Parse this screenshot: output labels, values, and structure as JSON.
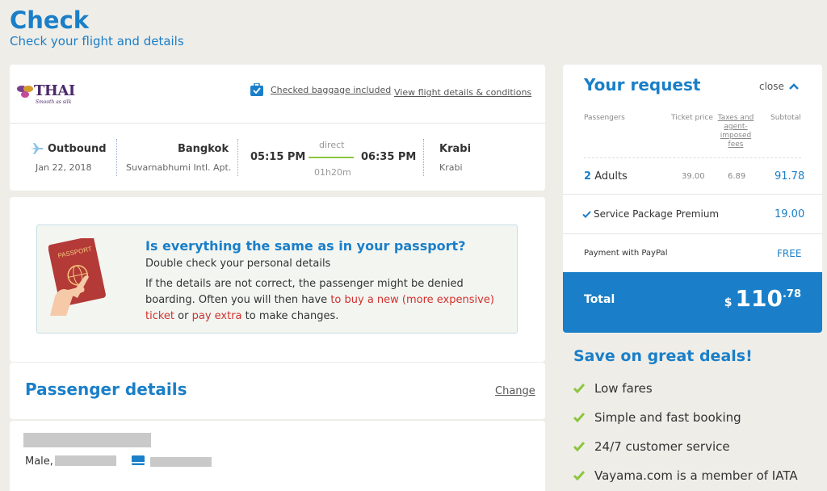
{
  "page": {
    "title": "Check",
    "subtitle": "Check your flight and details"
  },
  "flight": {
    "airline_logo_text": "THAI",
    "airline_logo_tagline": "Smooth as silk",
    "baggage_label": "Checked baggage included",
    "details_link": "View flight details & conditions",
    "direction": "Outbound",
    "date": "Jan 22, 2018",
    "origin_city": "Bangkok",
    "origin_airport": "Suvarnabhumi Intl. Apt.",
    "depart_time": "05:15 PM",
    "stop_type": "direct",
    "arrive_time": "06:35 PM",
    "duration": "01h20m",
    "dest_city": "Krabi",
    "dest_airport": "Krabi"
  },
  "passport_warning": {
    "title": "Is everything the same as in your passport?",
    "subtitle": "Double check your personal details",
    "body_1": "If the details are not correct, the passenger might be denied boarding. Often you will then have ",
    "link_1": "to buy a new (more expensive) ticket",
    "body_2": " or ",
    "link_2": "pay extra",
    "body_3": " to make changes.",
    "passport_label": "PASSPORT"
  },
  "passenger": {
    "title": "Passenger details",
    "change_label": "Change",
    "gender": "Male,"
  },
  "request": {
    "title": "Your request",
    "close_label": "close",
    "headers": {
      "passengers": "Passengers",
      "ticket_price": "Ticket price",
      "taxes": "Taxes and agent-imposed fees",
      "subtotal": "Subtotal"
    },
    "adults_count": "2",
    "adults_label": "Adults",
    "ticket_price": "39.00",
    "taxes": "6.89",
    "subtotal": "91.78",
    "service_label": "Service Package Premium",
    "service_price": "19.00",
    "payment_label": "Payment with PayPal",
    "payment_price": "FREE",
    "total_label": "Total",
    "total_currency": "$",
    "total_int": "110",
    "total_dec": ".78"
  },
  "deals": {
    "title": "Save on great deals!",
    "items": [
      "Low fares",
      "Simple and fast booking",
      "24/7 customer service",
      "Vayama.com is a member of IATA"
    ]
  },
  "colors": {
    "accent": "#1a7fc8",
    "green": "#8cc63f",
    "red": "#d0312d"
  }
}
